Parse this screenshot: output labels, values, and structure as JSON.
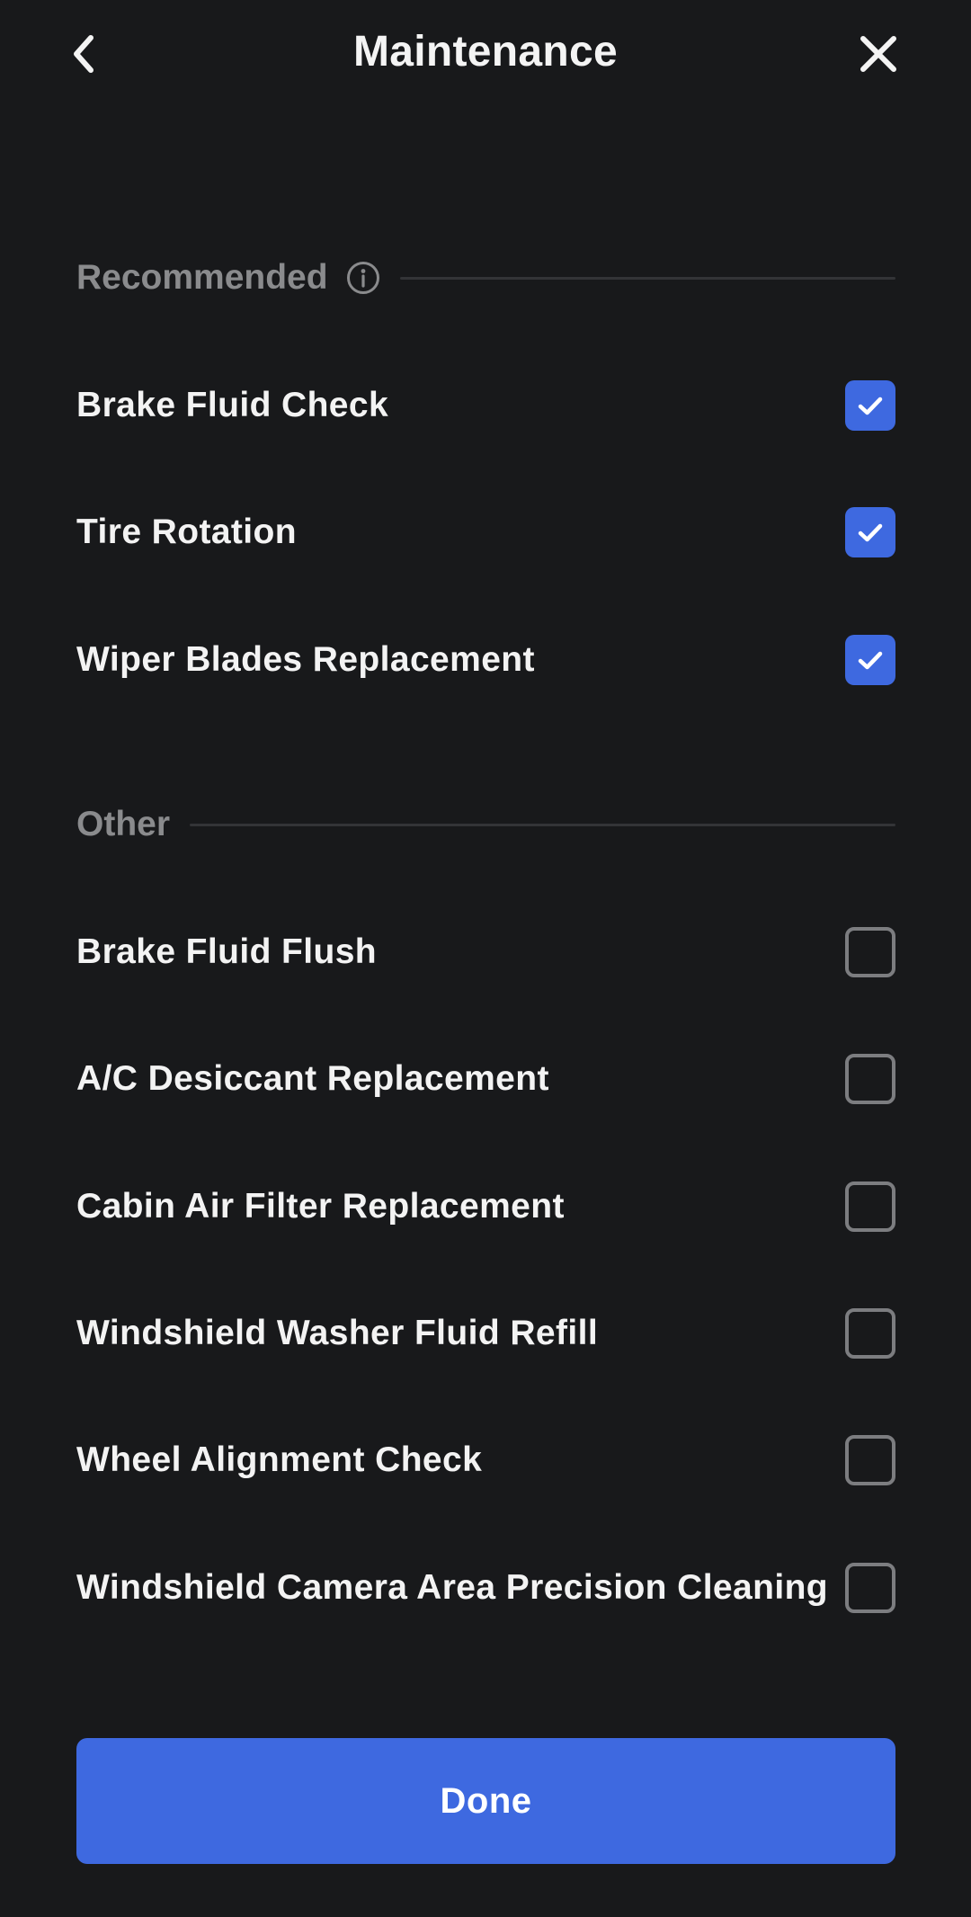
{
  "header": {
    "title": "Maintenance",
    "back_icon": "chevron-left-icon",
    "close_icon": "close-icon"
  },
  "sections": {
    "recommended": {
      "title": "Recommended",
      "info_icon": "info-icon",
      "items": [
        {
          "label": "Brake Fluid Check",
          "checked": true
        },
        {
          "label": "Tire Rotation",
          "checked": true
        },
        {
          "label": "Wiper Blades Replacement",
          "checked": true
        }
      ]
    },
    "other": {
      "title": "Other",
      "items": [
        {
          "label": "Brake Fluid Flush",
          "checked": false
        },
        {
          "label": "A/C Desiccant Replacement",
          "checked": false
        },
        {
          "label": "Cabin Air Filter Replacement",
          "checked": false
        },
        {
          "label": "Windshield Washer Fluid Refill",
          "checked": false
        },
        {
          "label": "Wheel Alignment Check",
          "checked": false
        },
        {
          "label": "Windshield Camera Area Precision Cleaning",
          "checked": false
        }
      ]
    }
  },
  "footer": {
    "done_label": "Done"
  },
  "colors": {
    "background": "#18191b",
    "accent": "#3e69e0",
    "section_title": "#8a8b8d",
    "checkbox_border": "#7c7d80"
  }
}
